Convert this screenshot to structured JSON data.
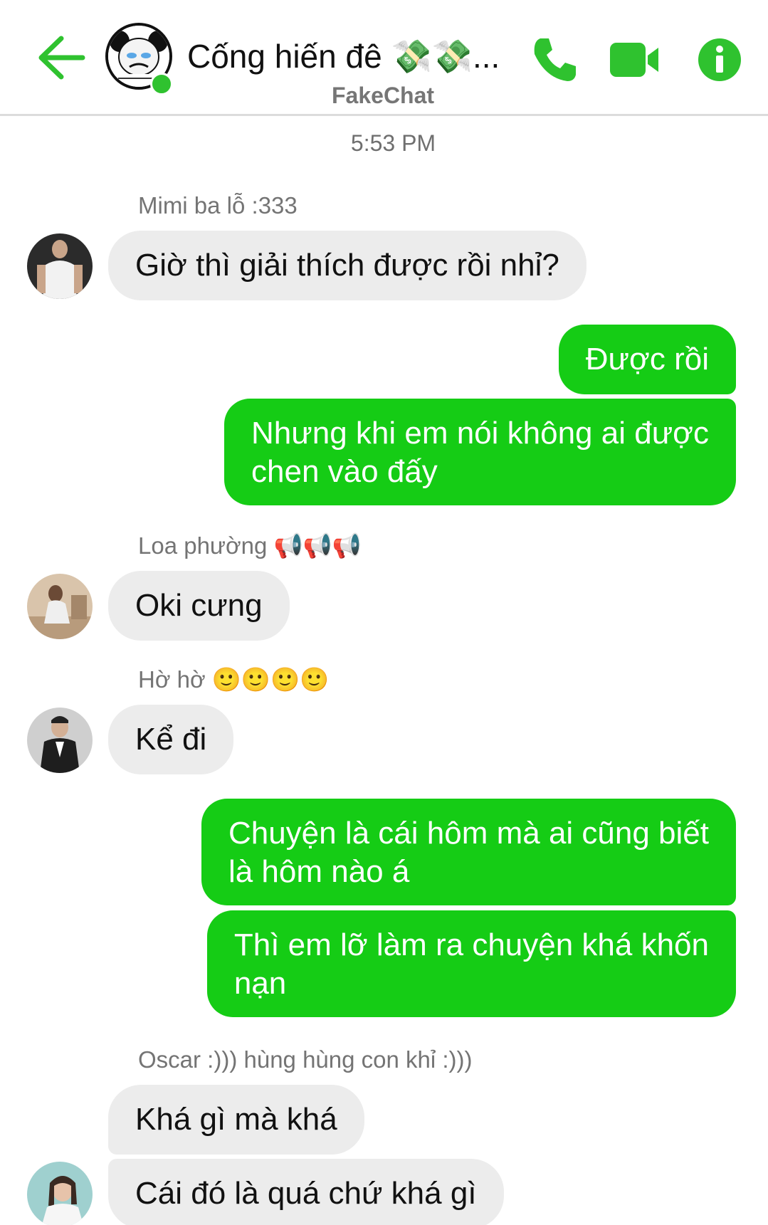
{
  "header": {
    "title": "Cống hiến đê 💸💸...",
    "subtitle": "FakeChat",
    "accent_color": "#2fc22f",
    "icons": [
      "back-arrow-icon",
      "phone-icon",
      "video-camera-icon",
      "info-icon"
    ]
  },
  "chat": {
    "timestamp": "5:53 PM",
    "messages": [
      {
        "sender": "Mimi ba lỗ :333",
        "direction": "in",
        "text": "Giờ thì giải thích được rồi nhỉ?"
      },
      {
        "direction": "out",
        "text": "Được rồi"
      },
      {
        "direction": "out",
        "text": "Nhưng khi em nói không ai được chen vào đấy"
      },
      {
        "sender": "Loa phường 📢📢📢",
        "direction": "in",
        "text": "Oki cưng"
      },
      {
        "sender": "Hờ hờ 🙂🙂🙂🙂",
        "direction": "in",
        "text": "Kể đi"
      },
      {
        "direction": "out",
        "text": "Chuyện là cái hôm mà ai cũng biết là hôm nào á"
      },
      {
        "direction": "out",
        "text": "Thì em lỡ làm ra chuyện khá khốn nạn"
      },
      {
        "sender": "Oscar :))) hùng hùng con khỉ :)))",
        "direction": "in",
        "text": "Khá gì mà khá"
      },
      {
        "direction": "in",
        "text": "Cái đó là quá chứ khá gì"
      }
    ]
  },
  "display": {
    "out_line_1": [
      "Nhưng khi em nói không ai được",
      "chen vào đấy"
    ],
    "out_line_2": [
      "Chuyện là cái hôm mà ai cũng biết",
      "là hôm nào á"
    ],
    "out_line_3": [
      "Thì em lỡ làm ra chuyện khá khốn",
      "nạn"
    ]
  },
  "colors": {
    "outgoing_bubble": "#15cc15",
    "incoming_bubble": "#ececec",
    "icon_green": "#2fc22f"
  }
}
